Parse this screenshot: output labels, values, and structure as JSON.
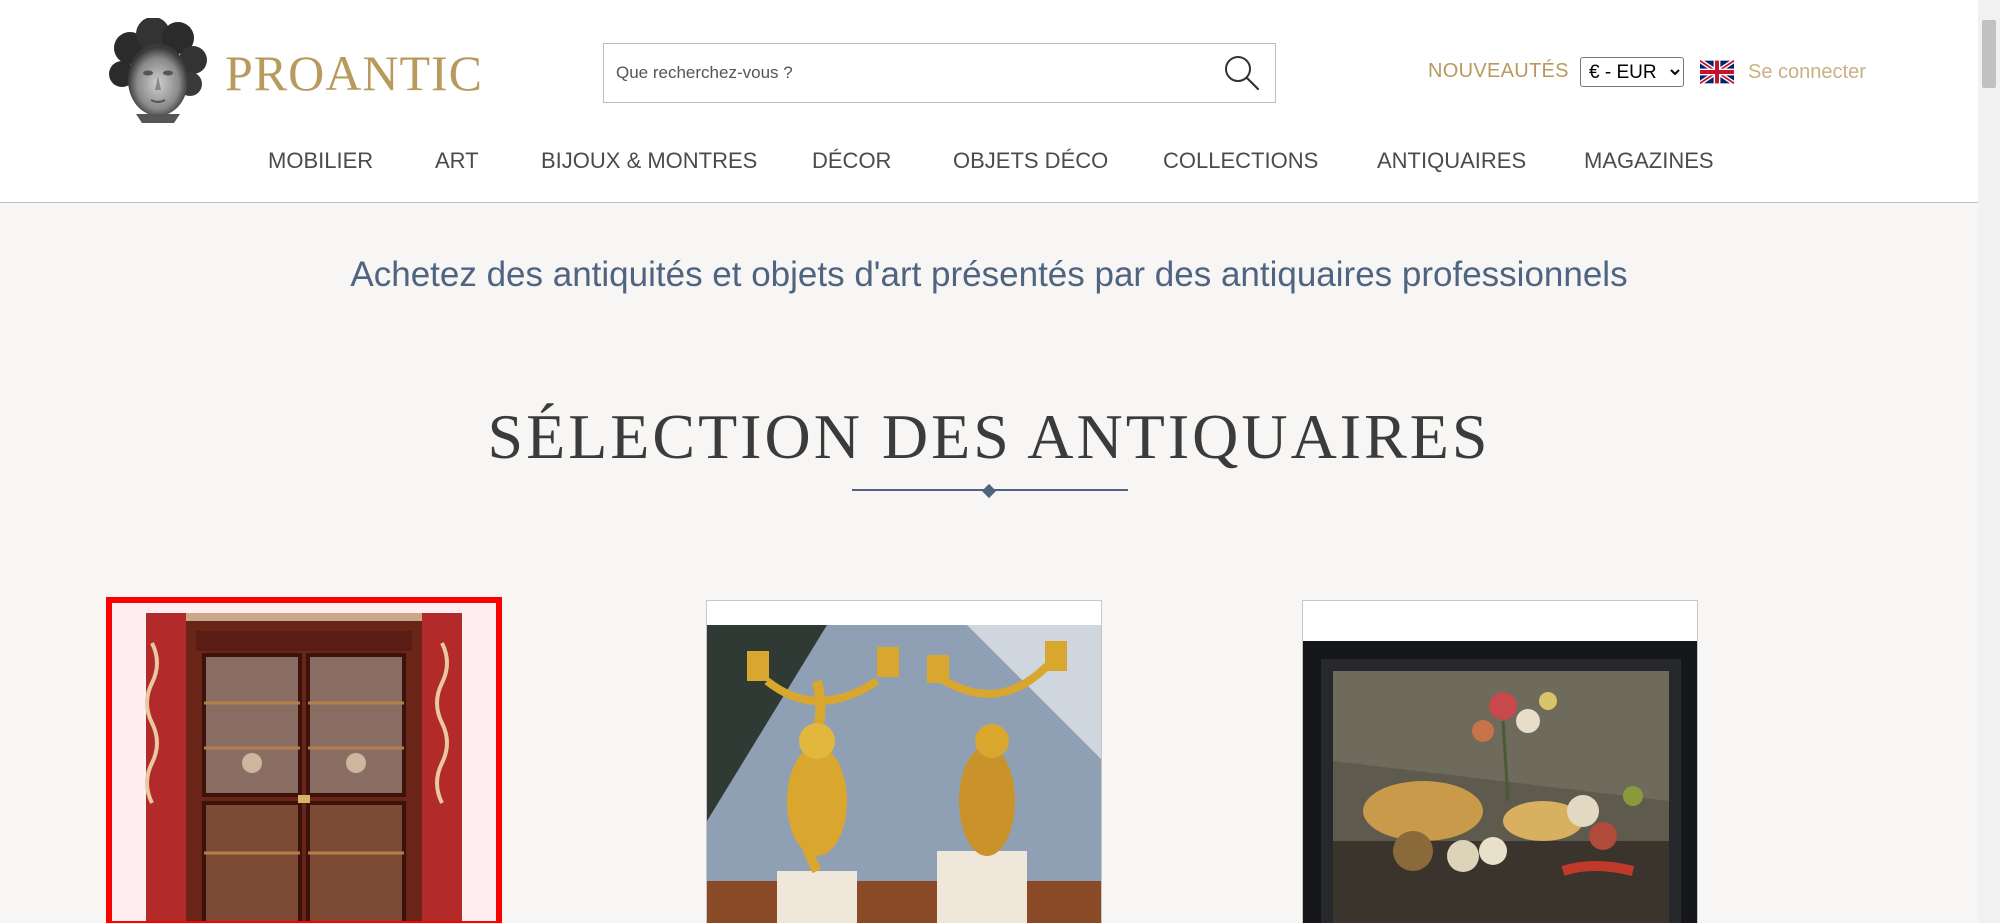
{
  "header": {
    "logo_text": "PROANTIC",
    "search_placeholder": "Que recherchez-vous ?",
    "nouveautes_label": "NOUVEAUTÉS",
    "currency": {
      "selected": "€ - EUR",
      "options": [
        "€ - EUR"
      ]
    },
    "language_flag": "uk-flag-icon",
    "login_label": "Se connecter"
  },
  "nav": {
    "items": [
      {
        "label": "MOBILIER"
      },
      {
        "label": "ART"
      },
      {
        "label": "BIJOUX & MONTRES"
      },
      {
        "label": "DÉCOR"
      },
      {
        "label": "OBJETS DÉCO"
      },
      {
        "label": "COLLECTIONS"
      },
      {
        "label": "ANTIQUAIRES"
      },
      {
        "label": "MAGAZINES"
      }
    ]
  },
  "main": {
    "tagline": "Achetez des antiquités et objets d'art présentés par des antiquaires professionnels",
    "section_title": "SÉLECTION DES ANTIQUAIRES",
    "products": [
      {
        "image": "bookcase-cabinet-image"
      },
      {
        "image": "gilt-bronze-candelabra-image"
      },
      {
        "image": "still-life-painting-image"
      }
    ]
  },
  "colors": {
    "brand_gold": "#b89a5e",
    "accent_blue": "#4e6480",
    "selection_red": "#ff0000"
  }
}
